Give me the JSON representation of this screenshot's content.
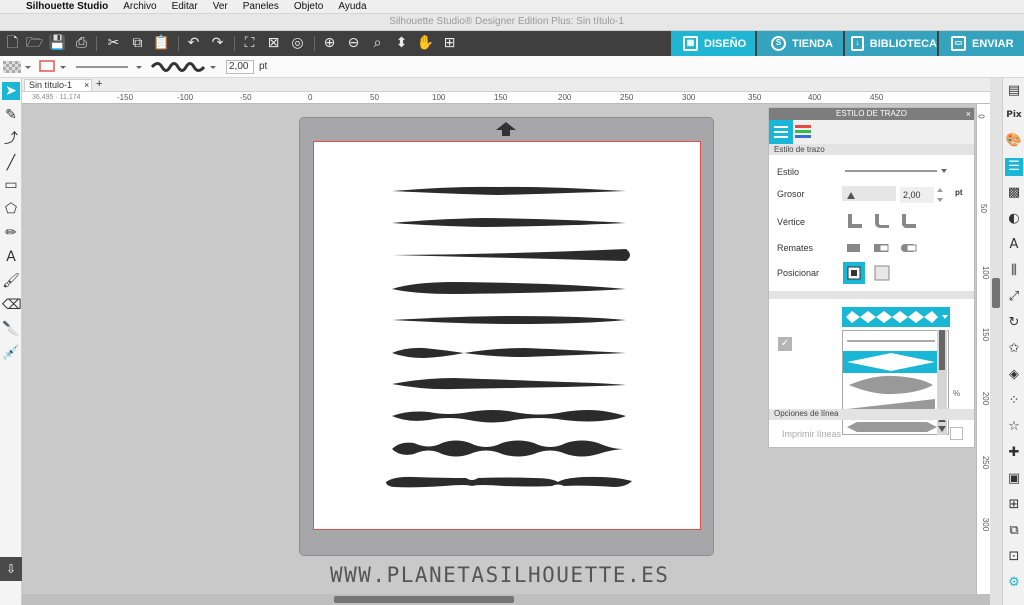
{
  "menubar": {
    "apple": "",
    "app": "Silhouette Studio",
    "items": [
      "Archivo",
      "Editar",
      "Ver",
      "Paneles",
      "Objeto",
      "Ayuda"
    ]
  },
  "window": {
    "title": "Silhouette Studio® Designer Edition Plus: Sin título-1"
  },
  "nav_tabs": {
    "design": "DISEÑO",
    "store": "TIENDA",
    "library": "BIBLIOTECA",
    "send": "ENVIAR"
  },
  "props": {
    "thickness": "2,00",
    "unit": "pt"
  },
  "doc": {
    "tab": "Sin título-1",
    "close": "×",
    "add": "+",
    "coords": "36,495 · 11,174"
  },
  "ruler": {
    "h": [
      "-150",
      "-100",
      "-50",
      "0",
      "50",
      "100",
      "150",
      "200",
      "250",
      "300",
      "350",
      "400",
      "450"
    ],
    "v": [
      "0",
      "50",
      "100",
      "150",
      "200",
      "250",
      "300"
    ]
  },
  "panel": {
    "title": "ESTILO DE TRAZO",
    "close": "×",
    "section": "Estilo de trazo",
    "style_label": "Estilo",
    "thickness_label": "Grosor",
    "thickness_value": "2,00",
    "thickness_unit": "pt",
    "vertex_label": "Vértice",
    "caps_label": "Remates",
    "position_label": "Posicionar",
    "options_label": "Opciones de línea",
    "print_label": "Imprimir líneas",
    "percent": "%"
  },
  "watermark": "WWW.PLANETASILHOUETTE.ES",
  "colors": {
    "accent": "#19b6d6",
    "toolbar": "#3f3f3f",
    "page_border": "#e15050"
  }
}
